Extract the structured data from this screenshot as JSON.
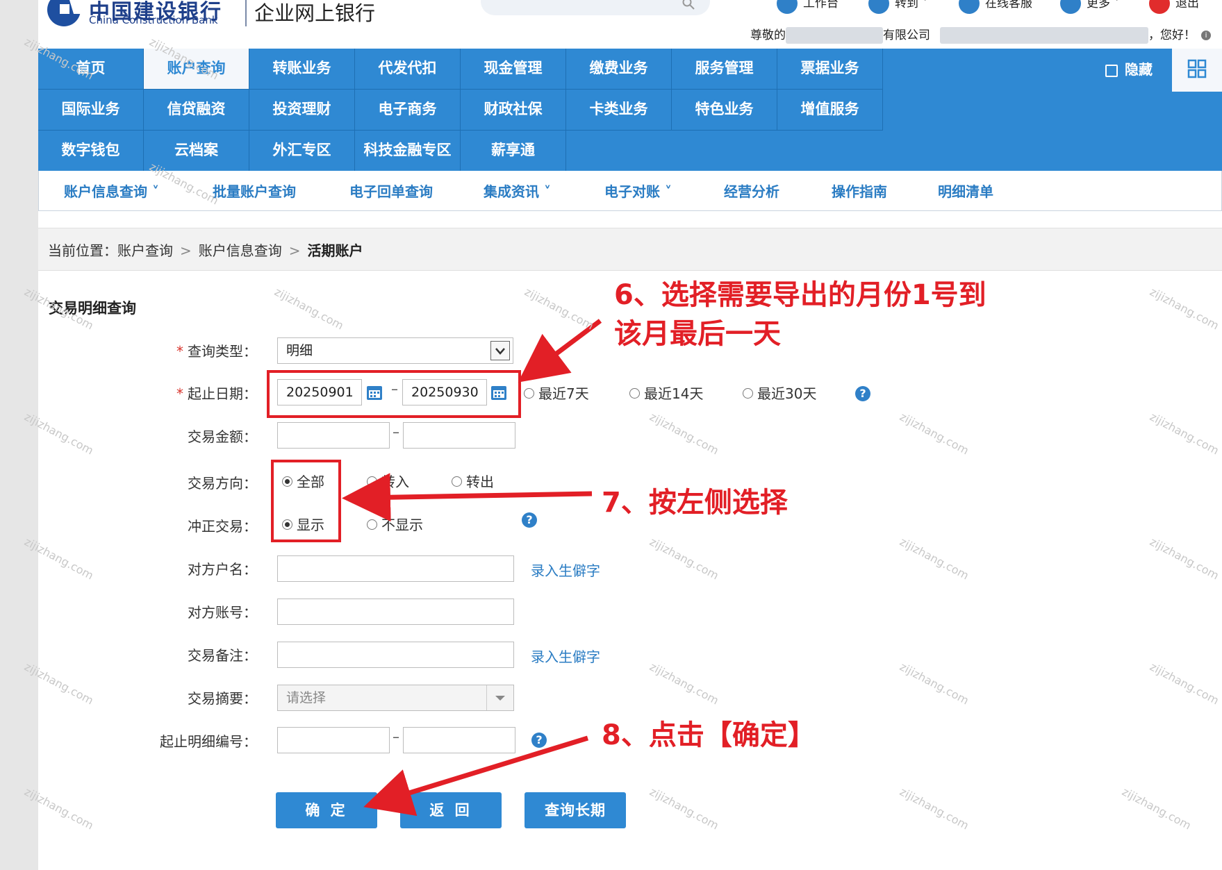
{
  "header": {
    "logo_cn": "中国建设银行",
    "logo_en": "China Construction Bank",
    "product": "企业网上银行",
    "tools": [
      {
        "label": "工作台",
        "icon": "workbench-icon"
      },
      {
        "label": "转到",
        "icon": "goto-icon"
      },
      {
        "label": "在线客服",
        "icon": "support-icon"
      },
      {
        "label": "更多",
        "icon": "more-icon"
      },
      {
        "label": "退出",
        "icon": "logout-icon"
      }
    ],
    "greeting_prefix": "尊敬的",
    "greeting_company_suffix": "有限公司",
    "greeting_suffix": "，您好！"
  },
  "nav": {
    "rows": [
      [
        "首页",
        "账户查询",
        "转账业务",
        "代发代扣",
        "现金管理",
        "缴费业务",
        "服务管理",
        "票据业务"
      ],
      [
        "国际业务",
        "信贷融资",
        "投资理财",
        "电子商务",
        "财政社保",
        "卡类业务",
        "特色业务",
        "增值服务"
      ],
      [
        "数字钱包",
        "云档案",
        "外汇专区",
        "科技金融专区",
        "薪享通"
      ]
    ],
    "active": "账户查询",
    "hide_label": "隐藏"
  },
  "subnav": {
    "items": [
      "账户信息查询 ˅",
      "批量账户查询",
      "电子回单查询",
      "集成资讯 ˅",
      "电子对账 ˅",
      "经营分析",
      "操作指南",
      "明细清单"
    ]
  },
  "breadcrumb": {
    "prefix": "当前位置：",
    "parts": [
      "账户查询",
      "账户信息查询"
    ],
    "current": "活期账户",
    "sep": ">"
  },
  "form": {
    "title": "交易明细查询",
    "query_type_label": "查询类型：",
    "query_type_value": "明细",
    "date_label": "起止日期：",
    "date_start": "20250901",
    "date_end": "20250930",
    "date_dash": "–",
    "date_quick": [
      "最近7天",
      "最近14天",
      "最近30天"
    ],
    "amount_label": "交易金额：",
    "direction_label": "交易方向：",
    "direction_options": [
      "全部",
      "转入",
      "转出"
    ],
    "direction_selected": "全部",
    "reversal_label": "冲正交易：",
    "reversal_options": [
      "显示",
      "不显示"
    ],
    "reversal_selected": "显示",
    "counterparty_name_label": "对方户名：",
    "counterparty_account_label": "对方账号：",
    "remark_label": "交易备注：",
    "rare_char_link": "录入生僻字",
    "summary_label": "交易摘要：",
    "summary_placeholder": "请选择",
    "serial_label": "起止明细编号：",
    "help_glyph": "?",
    "buttons": {
      "confirm": "确 定",
      "back": "返 回",
      "long_term": "查询长期"
    }
  },
  "annotations": {
    "step6_line1": "6、选择需要导出的月份1号到",
    "step6_line2": "该月最后一天",
    "step7": "7、按左侧选择",
    "step8": "8、点击【确定】",
    "color": "#e21f26"
  },
  "watermark": "zijizhang.com",
  "colors": {
    "nav_blue": "#2f89d3",
    "link_blue": "#2a7cc3",
    "annotation_red": "#e21f26"
  }
}
